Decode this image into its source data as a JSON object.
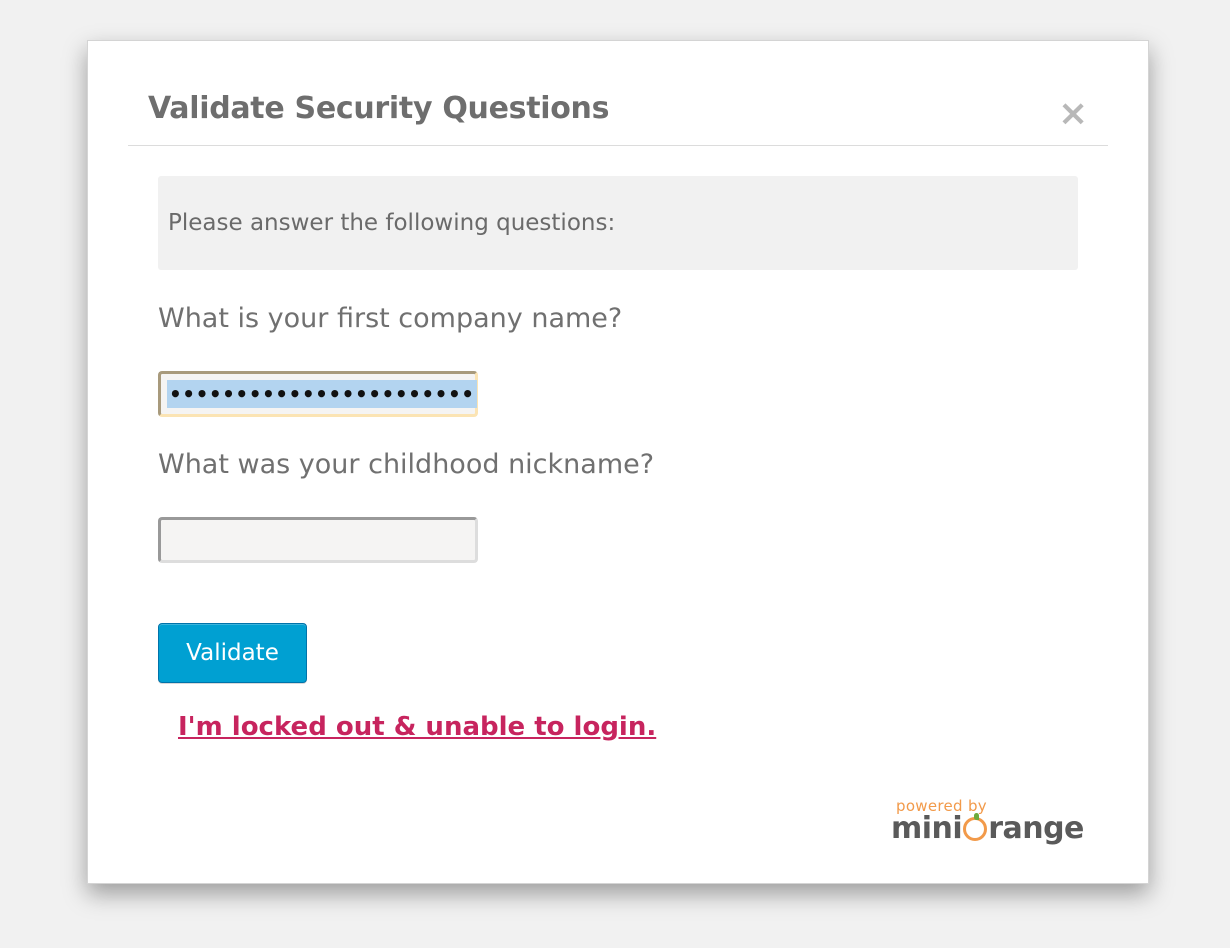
{
  "dialog": {
    "title": "Validate Security Questions",
    "close_symbol": "×",
    "info_text": "Please answer the following questions:"
  },
  "questions": [
    {
      "label": "What is your first company name?",
      "masked_value": "•••••••••••••••••••••••"
    },
    {
      "label": "What was your childhood nickname?",
      "masked_value": ""
    }
  ],
  "actions": {
    "validate_label": "Validate",
    "lockout_link": "I'm locked out & unable to login."
  },
  "branding": {
    "powered_by": "powered by",
    "brand_prefix": "mini",
    "brand_suffix": "range",
    "brand_full": "miniOrange"
  },
  "colors": {
    "button": "#00a0d2",
    "link": "#c7245e",
    "brand_orange": "#f29a4a"
  }
}
